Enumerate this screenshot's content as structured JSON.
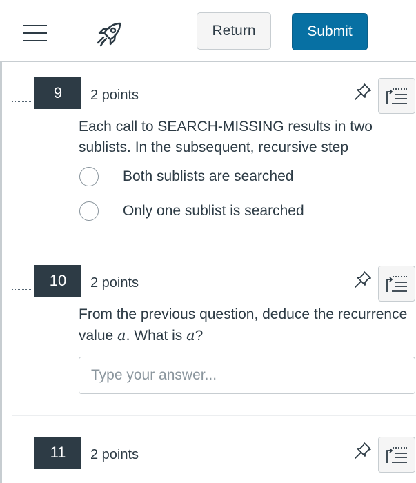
{
  "header": {
    "return_label": "Return",
    "submit_label": "Submit",
    "menu_icon": "hamburger-menu-icon",
    "quiz_icon": "rocket-icon",
    "colors": {
      "submit_bg": "#0770a3",
      "return_bg": "#f5f5f5"
    }
  },
  "questions": [
    {
      "number": "9",
      "points": "2 points",
      "text": "Each call to SEARCH-MISSING results in two sublists. In the subsequent, recursive step",
      "options": [
        {
          "label": "Both sublists are searched"
        },
        {
          "label": "Only one sublist is searched"
        }
      ]
    },
    {
      "number": "10",
      "points": "2 points",
      "text_parts": {
        "before": "From the previous question, deduce the recurrence value ",
        "var1": "a",
        "middle": ". What is ",
        "var2": "a",
        "after": "?"
      },
      "answer_placeholder": "Type your answer...",
      "answer_value": ""
    },
    {
      "number": "11",
      "points": "2 points"
    }
  ],
  "icons": {
    "pin": "pin-icon",
    "outline": "question-outline-icon"
  },
  "colors": {
    "question_number_bg": "#2d3b45",
    "text": "#2d3b45",
    "border": "#c7cdd1"
  }
}
